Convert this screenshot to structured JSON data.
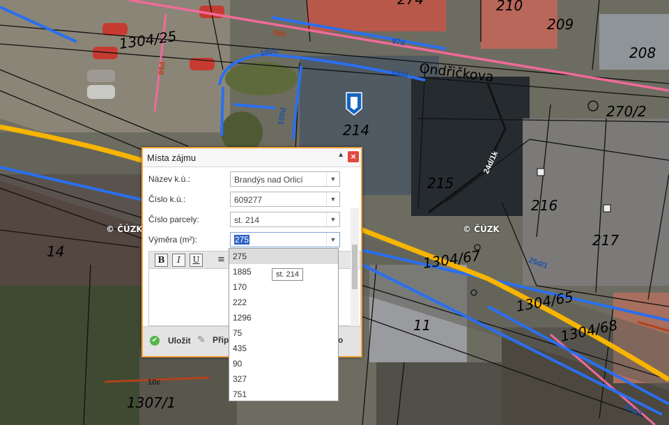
{
  "map": {
    "parcel_labels": [
      "1304/25",
      "209",
      "208",
      "214",
      "270/2",
      "215",
      "216",
      "217",
      "14",
      "1304/67",
      "11",
      "1304/65",
      "1304/68",
      "1307/1",
      "210",
      "274"
    ],
    "line_labels": [
      "98d",
      "97d",
      "100d",
      "100d",
      "100d",
      "99d",
      "24d/1k",
      "25d/1",
      "10c",
      "22d/1"
    ],
    "street_name": "Ondřičkova",
    "watermark": "© ČÚZK",
    "colors": {
      "power_line": "#2a6ff0",
      "pink_line": "#f06a9a",
      "yellow_road": "#f7b500",
      "brown_line": "#b3421a",
      "marker": "#1565c0"
    }
  },
  "dialog": {
    "title": "Místa zájmu",
    "fields": [
      {
        "label": "Název k.ú.:",
        "value": "Brandýs nad Orlicí"
      },
      {
        "label": "Číslo k.ú.:",
        "value": "609277"
      },
      {
        "label": "Číslo parcely:",
        "value": "st. 214"
      },
      {
        "label": "Výměra (m²):",
        "value": "275"
      }
    ],
    "toolbar": {
      "bold": "B",
      "italic": "I",
      "underline": "U"
    },
    "footer": {
      "save": "Uložit",
      "pin": "Přip",
      "last": "o"
    }
  },
  "dropdown": {
    "options": [
      "275",
      "1885",
      "170",
      "222",
      "1296",
      "75",
      "435",
      "90",
      "327",
      "751"
    ],
    "highlighted": "275"
  },
  "tooltip": "st. 214"
}
